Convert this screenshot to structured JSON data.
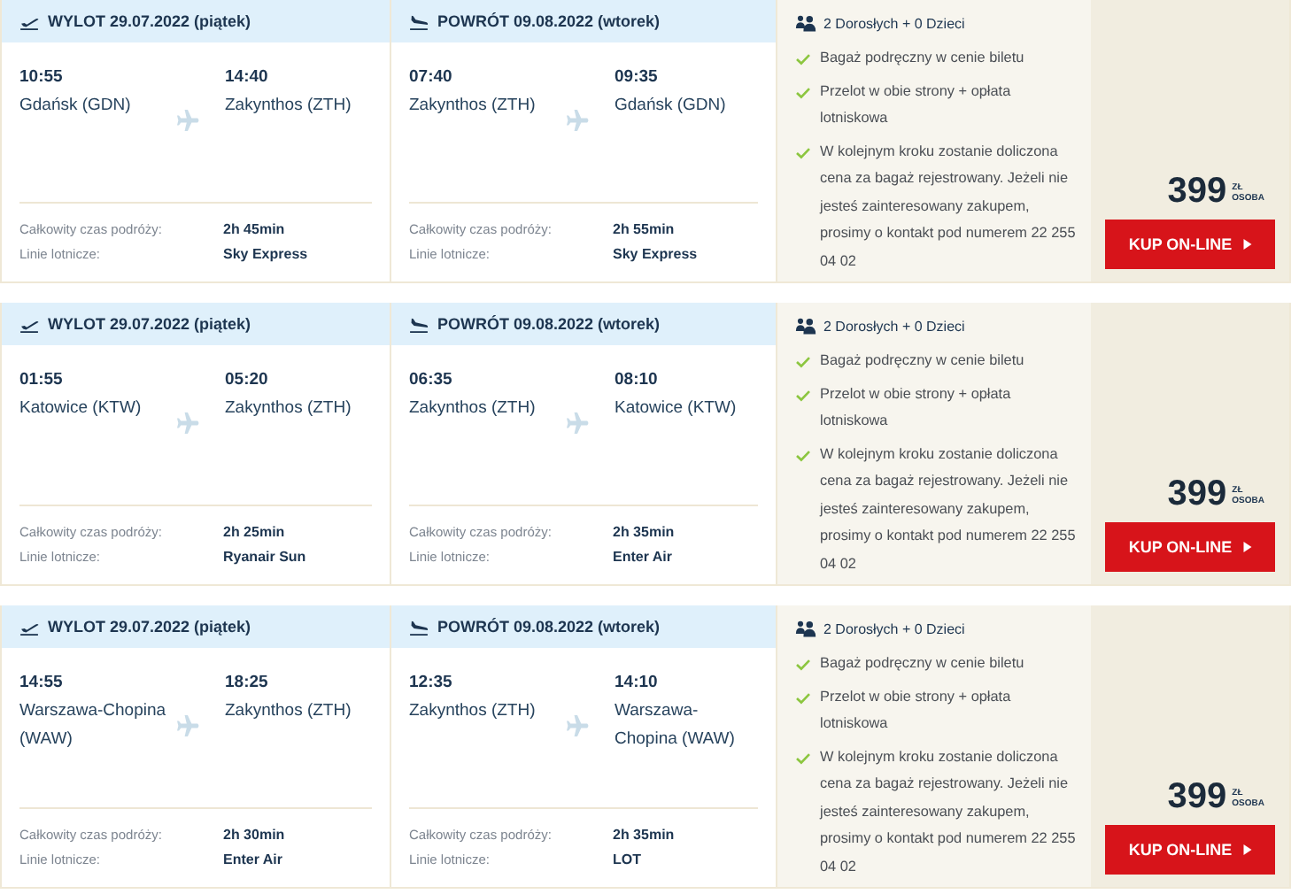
{
  "offers": [
    {
      "legs": [
        {
          "kind": "outbound",
          "label": "WYLOT 29.07.2022 (piątek)",
          "dep_time": "10:55",
          "dep_city": "Gdańsk (GDN)",
          "arr_time": "14:40",
          "arr_city": "Zakynthos (ZTH)",
          "duration_label": "Całkowity czas podróży:",
          "duration": "2h 45min",
          "airline_label": "Linie lotnicze:",
          "airline": "Sky Express"
        },
        {
          "kind": "return",
          "label": "POWRÓT 09.08.2022 (wtorek)",
          "dep_time": "07:40",
          "dep_city": "Zakynthos (ZTH)",
          "arr_time": "09:35",
          "arr_city": "Gdańsk (GDN)",
          "duration_label": "Całkowity czas podróży:",
          "duration": "2h 55min",
          "airline_label": "Linie lotnicze:",
          "airline": "Sky Express"
        }
      ],
      "passengers": "2 Dorosłych + 0 Dzieci",
      "features": [
        "Bagaż podręczny w cenie biletu",
        "Przelot w obie strony + opłata lotniskowa",
        "W kolejnym kroku zostanie doliczona cena za bagaż rejestrowany. Jeżeli nie jesteś zainteresowany zakupem, prosimy o kontakt pod numerem 22 255 04 02"
      ],
      "price": "399",
      "currency": "ZŁ",
      "per": "OSOBA",
      "button": "KUP ON-LINE"
    },
    {
      "legs": [
        {
          "kind": "outbound",
          "label": "WYLOT 29.07.2022 (piątek)",
          "dep_time": "01:55",
          "dep_city": "Katowice (KTW)",
          "arr_time": "05:20",
          "arr_city": "Zakynthos (ZTH)",
          "duration_label": "Całkowity czas podróży:",
          "duration": "2h 25min",
          "airline_label": "Linie lotnicze:",
          "airline": "Ryanair Sun"
        },
        {
          "kind": "return",
          "label": "POWRÓT 09.08.2022 (wtorek)",
          "dep_time": "06:35",
          "dep_city": "Zakynthos (ZTH)",
          "arr_time": "08:10",
          "arr_city": "Katowice (KTW)",
          "duration_label": "Całkowity czas podróży:",
          "duration": "2h 35min",
          "airline_label": "Linie lotnicze:",
          "airline": "Enter Air"
        }
      ],
      "passengers": "2 Dorosłych + 0 Dzieci",
      "features": [
        "Bagaż podręczny w cenie biletu",
        "Przelot w obie strony + opłata lotniskowa",
        "W kolejnym kroku zostanie doliczona cena za bagaż rejestrowany. Jeżeli nie jesteś zainteresowany zakupem, prosimy o kontakt pod numerem 22 255 04 02"
      ],
      "price": "399",
      "currency": "ZŁ",
      "per": "OSOBA",
      "button": "KUP ON-LINE"
    },
    {
      "legs": [
        {
          "kind": "outbound",
          "label": "WYLOT 29.07.2022 (piątek)",
          "dep_time": "14:55",
          "dep_city": "Warszawa-Chopina (WAW)",
          "arr_time": "18:25",
          "arr_city": "Zakynthos (ZTH)",
          "duration_label": "Całkowity czas podróży:",
          "duration": "2h 30min",
          "airline_label": "Linie lotnicze:",
          "airline": "Enter Air"
        },
        {
          "kind": "return",
          "label": "POWRÓT 09.08.2022 (wtorek)",
          "dep_time": "12:35",
          "dep_city": "Zakynthos (ZTH)",
          "arr_time": "14:10",
          "arr_city": "Warszawa-Chopina (WAW)",
          "duration_label": "Całkowity czas podróży:",
          "duration": "2h 35min",
          "airline_label": "Linie lotnicze:",
          "airline": "LOT"
        }
      ],
      "passengers": "2 Dorosłych + 0 Dzieci",
      "features": [
        "Bagaż podręczny w cenie biletu",
        "Przelot w obie strony + opłata lotniskowa",
        "W kolejnym kroku zostanie doliczona cena za bagaż rejestrowany. Jeżeli nie jesteś zainteresowany zakupem, prosimy o kontakt pod numerem 22 255 04 02"
      ],
      "price": "399",
      "currency": "ZŁ",
      "per": "OSOBA",
      "button": "KUP ON-LINE"
    }
  ]
}
